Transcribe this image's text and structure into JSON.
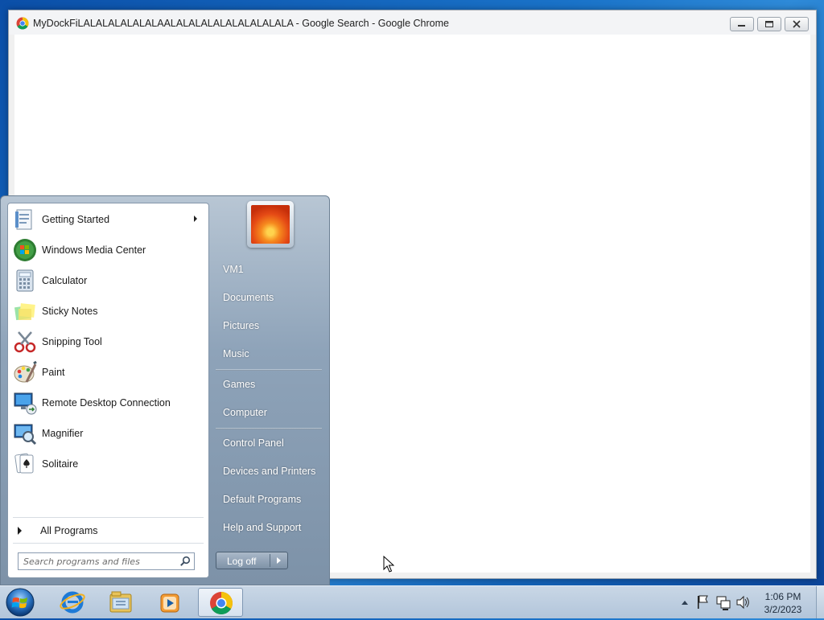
{
  "window": {
    "title": "MyDockFiLALALALALALALAALALALALALALALALALALA - Google Search - Google Chrome",
    "minimize_icon": "minimize-icon",
    "restore_icon": "restore-icon",
    "close_icon": "close-icon"
  },
  "start_menu": {
    "programs": [
      {
        "label": "Getting Started",
        "icon": "getting-started-icon",
        "has_submenu": true
      },
      {
        "label": "Windows Media Center",
        "icon": "windows-media-center-icon"
      },
      {
        "label": "Calculator",
        "icon": "calculator-icon"
      },
      {
        "label": "Sticky Notes",
        "icon": "sticky-notes-icon"
      },
      {
        "label": "Snipping Tool",
        "icon": "snipping-tool-icon"
      },
      {
        "label": "Paint",
        "icon": "paint-icon"
      },
      {
        "label": "Remote Desktop Connection",
        "icon": "remote-desktop-icon"
      },
      {
        "label": "Magnifier",
        "icon": "magnifier-icon"
      },
      {
        "label": "Solitaire",
        "icon": "solitaire-icon"
      }
    ],
    "all_programs": "All Programs",
    "search_placeholder": "Search programs and files",
    "right_items": [
      "VM1",
      "Documents",
      "Pictures",
      "Music",
      "Games",
      "Computer",
      "Control Panel",
      "Devices and Printers",
      "Default Programs",
      "Help and Support"
    ],
    "logoff": "Log off"
  },
  "taskbar": {
    "items": [
      "start-orb",
      "internet-explorer-icon",
      "windows-explorer-icon",
      "windows-media-player-icon",
      "google-chrome-icon"
    ],
    "active": "google-chrome-icon",
    "tray_icons": [
      "show-hidden-icons-icon",
      "action-center-flag-icon",
      "network-icon",
      "volume-icon"
    ],
    "time": "1:06 PM",
    "date": "3/2/2023"
  }
}
